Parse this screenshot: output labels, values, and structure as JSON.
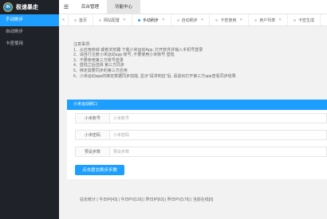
{
  "sidebar": {
    "logo_badge": "IN",
    "logo_text": "极速暴走",
    "items": [
      {
        "label": "手动刷步",
        "active": true
      },
      {
        "label": "自动刷步",
        "active": false
      },
      {
        "label": "卡密使用",
        "active": false
      }
    ]
  },
  "header": {
    "menu_icon": "☰",
    "nav": [
      {
        "label": "后台管理",
        "active": false
      },
      {
        "label": "功能中心",
        "active": true
      }
    ]
  },
  "tabs": {
    "left_arrow": "«",
    "right_arrow": "»",
    "close_glyph": "✕",
    "items": [
      {
        "label": "首页",
        "active": false,
        "closable": false
      },
      {
        "label": "网站配置",
        "active": false,
        "closable": true
      },
      {
        "label": "手动刷步",
        "active": true,
        "closable": true
      },
      {
        "label": "自动刷步",
        "active": false,
        "closable": true
      },
      {
        "label": "卡密使用",
        "active": false,
        "closable": true
      },
      {
        "label": "用户列表",
        "active": false,
        "closable": true
      },
      {
        "label": "卡密生成",
        "active": false,
        "closable": true
      }
    ]
  },
  "notice": {
    "title": "注意事项:",
    "lines": [
      "1、从应用商城 或者浏览器 下载小米运动App, 打开软件并输入手机号登录",
      "2、请自行注册小米运动app 账号, 不要使用小米账号 登陆",
      "3、不要使用第三方账号登录",
      "4、登陆之后选择 第三方同步",
      "5、绑定需要同步的第三方应用",
      "6、小米运动app的绑定数据同步前能, 显示\"请求响应\"后, 请退出打开第三方app查看同步结果"
    ]
  },
  "form": {
    "title": "小米运动刷口",
    "fields": [
      {
        "label": "小米账号",
        "placeholder": "小米账号",
        "value": ""
      },
      {
        "label": "小米密码",
        "placeholder": "小米密码",
        "value": ""
      },
      {
        "label": "预设步数",
        "placeholder": "预设步数",
        "value": ""
      }
    ],
    "submit_label": "点击提交刷步步数"
  },
  "stats": {
    "text": "站长统计 | 今日IP[43] | 今日PV[116] | 昨日IP[63] | 昨日PV[179] | 当前在线[0]"
  },
  "colors": {
    "accent": "#1e9fff",
    "sidebar_bg": "#20222a"
  }
}
